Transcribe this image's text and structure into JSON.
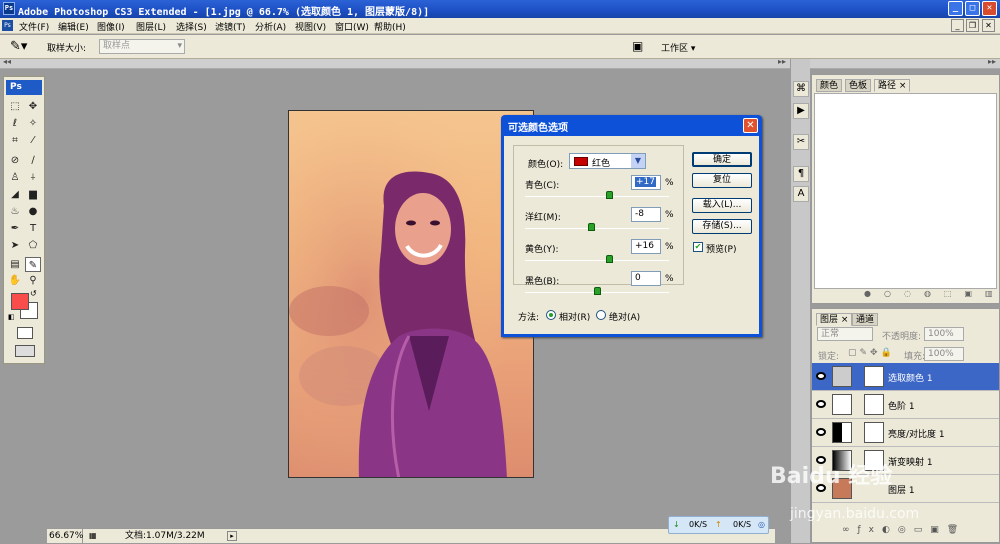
{
  "window": {
    "app_icon": "Ps",
    "title": "Adobe Photoshop CS3 Extended - [1.jpg @ 66.7% (选取颜色 1, 图层蒙版/8)]",
    "controls": {
      "minimize": "_",
      "maximize": "□",
      "close": "✕"
    }
  },
  "menu": {
    "items": [
      "文件(F)",
      "编辑(E)",
      "图像(I)",
      "图层(L)",
      "选择(S)",
      "滤镜(T)",
      "分析(A)",
      "视图(V)",
      "窗口(W)",
      "帮助(H)"
    ],
    "doc_controls": {
      "minimize": "_",
      "restore": "❐",
      "close": "✕"
    }
  },
  "options": {
    "sample_size_label": "取样大小:",
    "sample_size_value": "取样点",
    "workspace": "工作区 ▾"
  },
  "toolbox": {
    "logo": "Ps"
  },
  "status": {
    "zoom": "66.67%",
    "doc": "文档:1.07M/3.22M"
  },
  "top_panel": {
    "tabs": [
      "颜色",
      "色板",
      "路径 ×"
    ]
  },
  "layers_panel": {
    "tabs": [
      "图层 ×",
      "通道"
    ],
    "blend_mode": "正常",
    "opacity_label": "不透明度:",
    "opacity_value": "100%",
    "lock_label": "锁定:",
    "fill_label": "填充:",
    "fill_value": "100%",
    "layers": [
      {
        "name": "选取颜色 1",
        "selected": true
      },
      {
        "name": "色阶 1",
        "selected": false
      },
      {
        "name": "亮度/对比度 1",
        "selected": false
      },
      {
        "name": "渐变映射 1",
        "selected": false
      },
      {
        "name": "图层 1",
        "selected": false
      }
    ]
  },
  "dialog": {
    "title": "可选颜色选项",
    "color_label": "颜色(O):",
    "color_value": "红色",
    "color_hex": "#c40000",
    "sliders": [
      {
        "label": "青色(C):",
        "value": "+17",
        "level": 0.585
      },
      {
        "label": "洋红(M):",
        "value": "-8",
        "level": 0.46
      },
      {
        "label": "黄色(Y):",
        "value": "+16",
        "level": 0.58
      },
      {
        "label": "黑色(B):",
        "value": "0",
        "level": 0.5
      }
    ],
    "percent": "%",
    "buttons": {
      "ok": "确定",
      "reset": "复位",
      "load": "载入(L)...",
      "save": "存储(S)..."
    },
    "preview_label": "预览(P)",
    "method_label": "方法:",
    "method_relative": "相对(R)",
    "method_absolute": "绝对(A)"
  },
  "network": {
    "down": "0K/S",
    "up": "0K/S"
  },
  "watermark": {
    "line1": "Baidu 经验",
    "line2": "jingyan.baidu.com"
  }
}
